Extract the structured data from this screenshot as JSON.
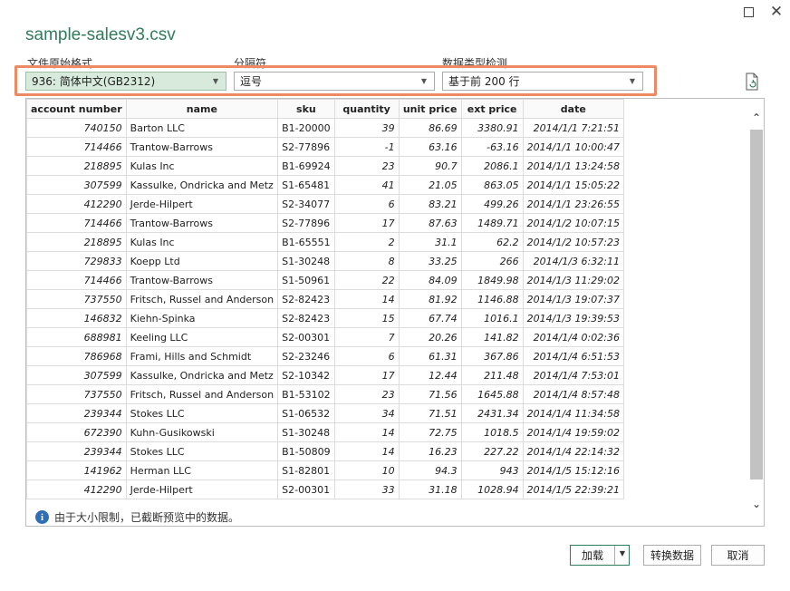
{
  "window": {
    "title": "sample-salesv3.csv",
    "maximize_icon": "maximize-icon",
    "close_icon": "close-icon",
    "close_glyph": "✕"
  },
  "options": {
    "origin": {
      "label": "文件原始格式",
      "value": "936: 简体中文(GB2312)"
    },
    "delimiter": {
      "label": "分隔符",
      "value": "逗号"
    },
    "detection": {
      "label": "数据类型检测",
      "value": "基于前 200 行"
    },
    "highlight_color": "#ee8a63",
    "refresh_icon": "refresh-file-icon"
  },
  "table": {
    "columns": [
      "account number",
      "name",
      "sku",
      "quantity",
      "unit price",
      "ext price",
      "date"
    ],
    "rows": [
      [
        "740150",
        "Barton LLC",
        "B1-20000",
        "39",
        "86.69",
        "3380.91",
        "2014/1/1 7:21:51"
      ],
      [
        "714466",
        "Trantow-Barrows",
        "S2-77896",
        "-1",
        "63.16",
        "-63.16",
        "2014/1/1 10:00:47"
      ],
      [
        "218895",
        "Kulas Inc",
        "B1-69924",
        "23",
        "90.7",
        "2086.1",
        "2014/1/1 13:24:58"
      ],
      [
        "307599",
        "Kassulke, Ondricka and Metz",
        "S1-65481",
        "41",
        "21.05",
        "863.05",
        "2014/1/1 15:05:22"
      ],
      [
        "412290",
        "Jerde-Hilpert",
        "S2-34077",
        "6",
        "83.21",
        "499.26",
        "2014/1/1 23:26:55"
      ],
      [
        "714466",
        "Trantow-Barrows",
        "S2-77896",
        "17",
        "87.63",
        "1489.71",
        "2014/1/2 10:07:15"
      ],
      [
        "218895",
        "Kulas Inc",
        "B1-65551",
        "2",
        "31.1",
        "62.2",
        "2014/1/2 10:57:23"
      ],
      [
        "729833",
        "Koepp Ltd",
        "S1-30248",
        "8",
        "33.25",
        "266",
        "2014/1/3 6:32:11"
      ],
      [
        "714466",
        "Trantow-Barrows",
        "S1-50961",
        "22",
        "84.09",
        "1849.98",
        "2014/1/3 11:29:02"
      ],
      [
        "737550",
        "Fritsch, Russel and Anderson",
        "S2-82423",
        "14",
        "81.92",
        "1146.88",
        "2014/1/3 19:07:37"
      ],
      [
        "146832",
        "Kiehn-Spinka",
        "S2-82423",
        "15",
        "67.74",
        "1016.1",
        "2014/1/3 19:39:53"
      ],
      [
        "688981",
        "Keeling LLC",
        "S2-00301",
        "7",
        "20.26",
        "141.82",
        "2014/1/4 0:02:36"
      ],
      [
        "786968",
        "Frami, Hills and Schmidt",
        "S2-23246",
        "6",
        "61.31",
        "367.86",
        "2014/1/4 6:51:53"
      ],
      [
        "307599",
        "Kassulke, Ondricka and Metz",
        "S2-10342",
        "17",
        "12.44",
        "211.48",
        "2014/1/4 7:53:01"
      ],
      [
        "737550",
        "Fritsch, Russel and Anderson",
        "B1-53102",
        "23",
        "71.56",
        "1645.88",
        "2014/1/4 8:57:48"
      ],
      [
        "239344",
        "Stokes LLC",
        "S1-06532",
        "34",
        "71.51",
        "2431.34",
        "2014/1/4 11:34:58"
      ],
      [
        "672390",
        "Kuhn-Gusikowski",
        "S1-30248",
        "14",
        "72.75",
        "1018.5",
        "2014/1/4 19:59:02"
      ],
      [
        "239344",
        "Stokes LLC",
        "B1-50809",
        "14",
        "16.23",
        "227.22",
        "2014/1/4 22:14:32"
      ],
      [
        "141962",
        "Herman LLC",
        "S1-82801",
        "10",
        "94.3",
        "943",
        "2014/1/5 15:12:16"
      ],
      [
        "412290",
        "Jerde-Hilpert",
        "S2-00301",
        "33",
        "31.18",
        "1028.94",
        "2014/1/5 22:39:21"
      ]
    ]
  },
  "notice": {
    "icon": "info-icon",
    "icon_glyph": "i",
    "text": "由于大小限制，已截断预览中的数据。"
  },
  "scrollbar": {
    "up_glyph": "⌃",
    "down_glyph": "⌄"
  },
  "buttons": {
    "load": "加载",
    "transform": "转换数据",
    "cancel": "取消"
  },
  "colors": {
    "title_green": "#2f7d5a",
    "selected_bg": "#d7eadb",
    "info_blue": "#2f6fb6"
  }
}
